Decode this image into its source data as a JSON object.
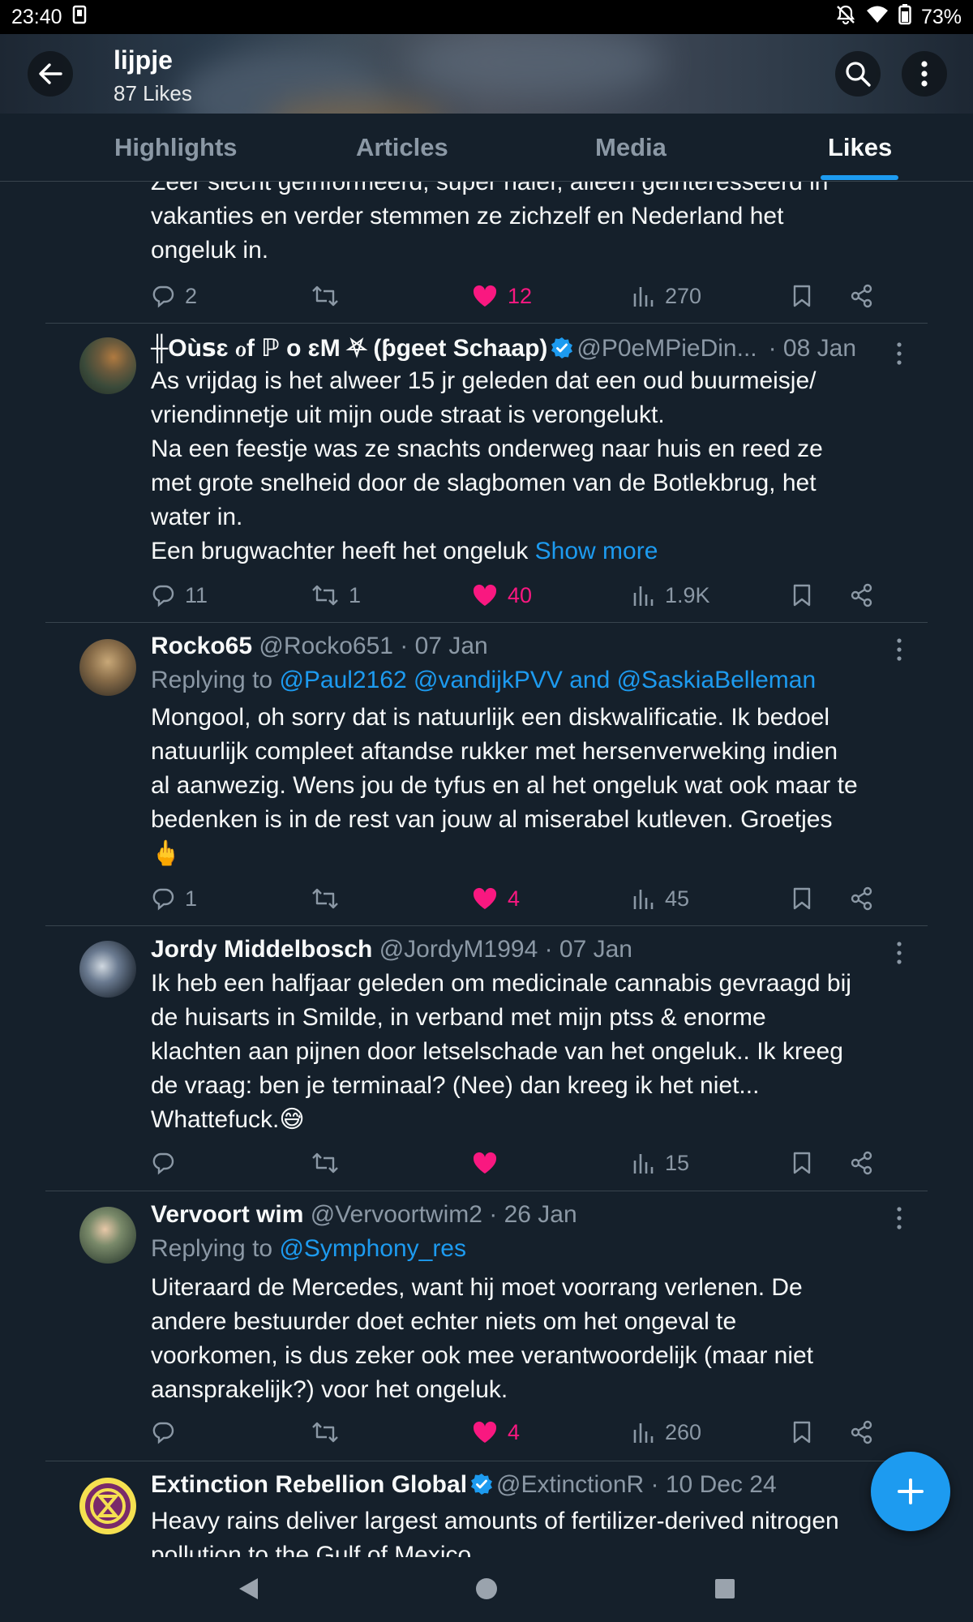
{
  "status": {
    "time": "23:40",
    "battery": "73%"
  },
  "header": {
    "title": "lijpje",
    "subtitle": "87 Likes"
  },
  "tabs": [
    {
      "label": "Highlights"
    },
    {
      "label": "Articles"
    },
    {
      "label": "Media"
    },
    {
      "label": "Likes",
      "active": true
    }
  ],
  "tweets": [
    {
      "body_lines": [
        "Zeer slecht geïnformeerd, super naief, alleen geinteresseerd in",
        "vakanties en verder stemmen ze zichzelf en Nederland het",
        "ongeluk in."
      ],
      "replies": "2",
      "retweets": "",
      "likes": "12",
      "views": "270"
    },
    {
      "name": "╫Oùꜱɛ ℴf ℙ ο ɛM ⛧ (ƥgeet Schaap)",
      "handle": "@P0eMPieDin...",
      "date": "· 08 Jan",
      "verified": true,
      "body_lines": [
        "As vrijdag is het alweer 15 jr geleden dat een oud buurmeisje/",
        "vriendinnetje uit mijn oude straat is verongelukt.",
        "Na een feestje was ze snachts onderweg naar huis en reed ze",
        "met grote snelheid door de slagbomen van de Botlekbrug, het",
        "water in.",
        "Een brugwachter heeft het ongeluk"
      ],
      "show_more": "Show more",
      "replies": "11",
      "retweets": "1",
      "likes": "40",
      "views": "1.9K"
    },
    {
      "name": "Rocko65",
      "handle": "@Rocko651 · 07 Jan",
      "replying_prefix": "Replying to",
      "replying_to": "@Paul2162 @vandijkPVV and @SaskiaBelleman",
      "body_lines": [
        "Mongool, oh sorry dat is natuurlijk een diskwalificatie.  Ik bedoel",
        "natuurlijk compleet aftandse rukker met hersenverweking indien",
        "al aanwezig. Wens jou de tyfus en al het ongeluk wat ook maar te",
        "bedenken is in de rest van jouw al miserabel kutleven. Groetjes",
        "🖕"
      ],
      "replies": "1",
      "retweets": "",
      "likes": "4",
      "views": "45"
    },
    {
      "name": "Jordy Middelbosch",
      "handle": "@JordyM1994 · 07 Jan",
      "body_lines": [
        "Ik heb een halfjaar geleden om medicinale cannabis gevraagd bij",
        "de huisarts in Smilde, in verband met mijn ptss & enorme",
        "klachten aan pijnen door letselschade van het ongeluk.. Ik kreeg",
        "de vraag: ben je terminaal? (Nee) dan kreeg ik het niet...",
        "Whattefuck.😅"
      ],
      "replies": "",
      "retweets": "",
      "likes": "",
      "views": "15"
    },
    {
      "name": "Vervoort wim",
      "handle": "@Vervoortwim2 · 26 Jan",
      "replying_prefix": "Replying to",
      "replying_to": "@Symphony_res",
      "body_lines": [
        "Uiteraard de Mercedes, want hij moet voorrang verlenen. De",
        "andere bestuurder doet echter niets om het ongeval te",
        "voorkomen, is dus zeker ook mee verantwoordelijk (maar niet",
        "aansprakelijk?) voor het ongeluk."
      ],
      "replies": "",
      "retweets": "",
      "likes": "4",
      "views": "260"
    },
    {
      "name": "Extinction Rebellion Global",
      "handle": "@ExtinctionR · 10 Dec 24",
      "verified": true,
      "body_lines": [
        "Heavy rains deliver largest amounts of fertilizer-derived nitrogen",
        "pollution to the Gulf of Mexico"
      ]
    }
  ],
  "colors": {
    "accent": "#1d9bf0",
    "like": "#f91880",
    "background": "#15202b",
    "muted": "#8b98a5"
  }
}
